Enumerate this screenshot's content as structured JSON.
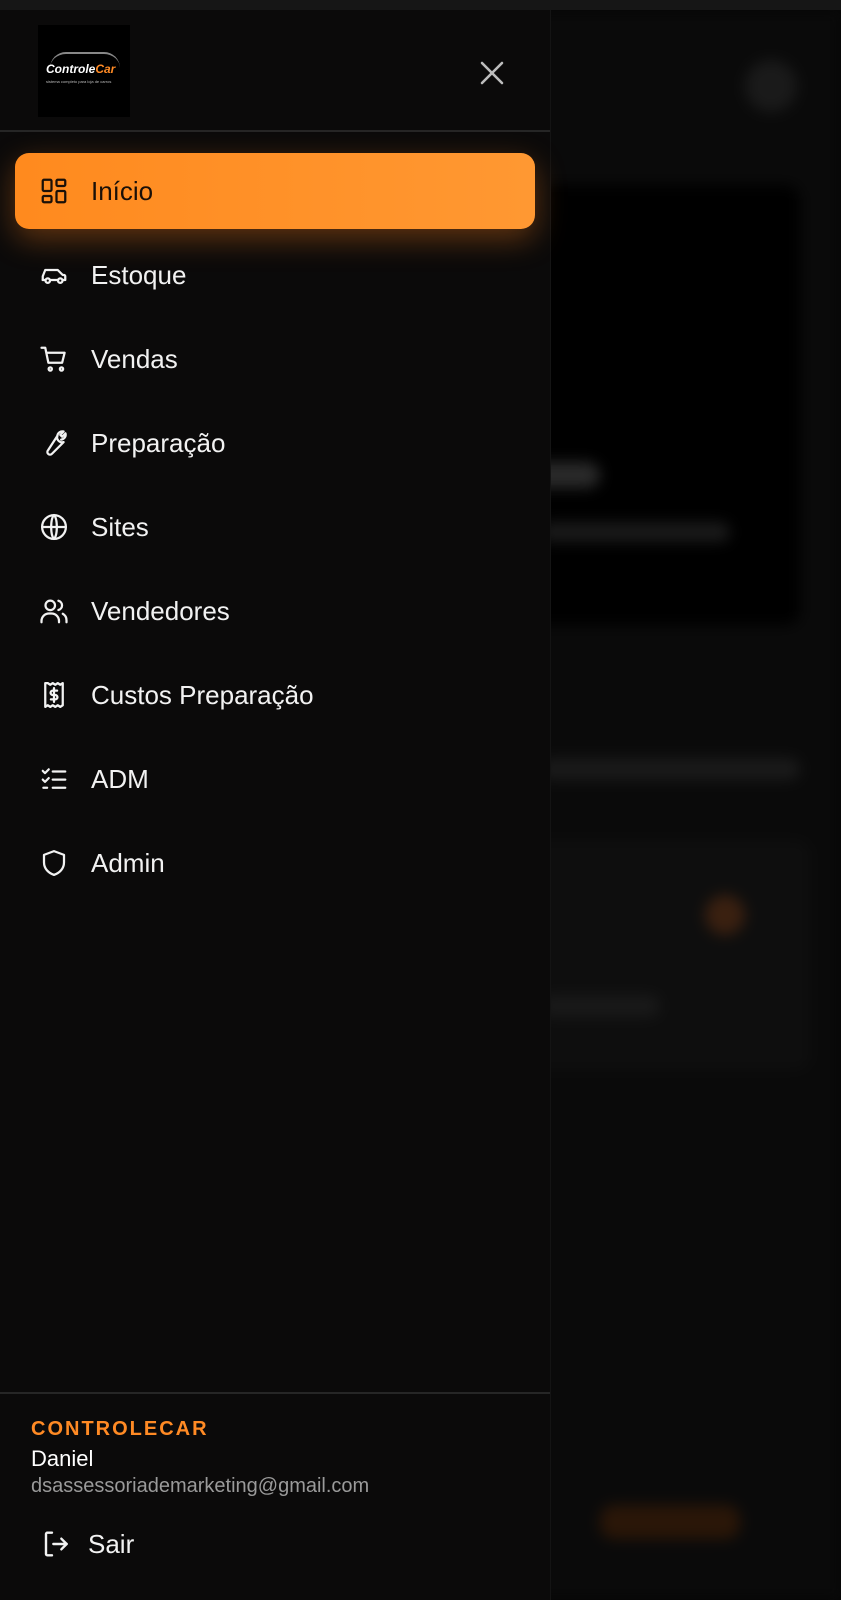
{
  "app": {
    "logo_text_main": "Controle",
    "logo_text_accent": "Car",
    "logo_tagline": "sistema completo para loja de carros"
  },
  "nav": {
    "items": [
      {
        "label": "Início",
        "icon": "dashboard-grid-icon",
        "active": true
      },
      {
        "label": "Estoque",
        "icon": "car-icon",
        "active": false
      },
      {
        "label": "Vendas",
        "icon": "shopping-cart-icon",
        "active": false
      },
      {
        "label": "Preparação",
        "icon": "wrench-icon",
        "active": false
      },
      {
        "label": "Sites",
        "icon": "globe-icon",
        "active": false
      },
      {
        "label": "Vendedores",
        "icon": "users-icon",
        "active": false
      },
      {
        "label": "Custos Preparação",
        "icon": "receipt-dollar-icon",
        "active": false
      },
      {
        "label": "ADM",
        "icon": "checklist-icon",
        "active": false
      },
      {
        "label": "Admin",
        "icon": "shield-icon",
        "active": false
      }
    ]
  },
  "footer": {
    "brand": "CONTROLECAR",
    "user_name": "Daniel",
    "user_email": "dsassessoriademarketing@gmail.com",
    "logout_label": "Sair"
  },
  "colors": {
    "accent": "#ff8a24",
    "drawer_bg": "#0b0a0a",
    "text": "#f2f2f2",
    "muted": "#9a9a9a"
  }
}
